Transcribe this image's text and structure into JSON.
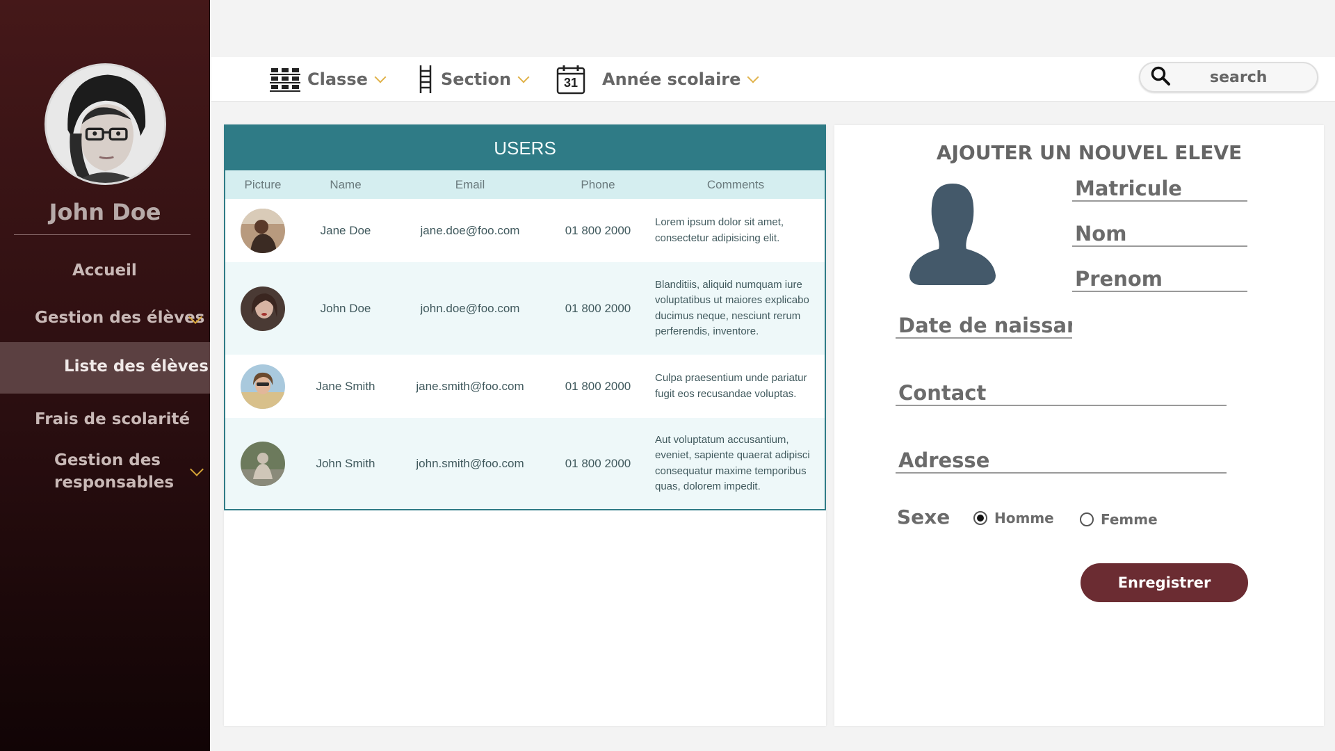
{
  "sidebar": {
    "user_name": "John Doe",
    "items": [
      {
        "label": "Accueil"
      },
      {
        "label": "Gestion des élèves"
      },
      {
        "label": "Liste des élèves"
      },
      {
        "label": "Frais de scolarité"
      },
      {
        "label": "Gestion des\nresponsables"
      }
    ]
  },
  "topbar": {
    "filters": [
      {
        "label": "Classe",
        "icon": "seats-grid-icon"
      },
      {
        "label": "Section",
        "icon": "ladder-icon"
      },
      {
        "label": "Année scolaire",
        "icon": "calendar-icon",
        "icon_text": "31"
      }
    ],
    "search_placeholder": "search"
  },
  "users_table": {
    "title": "USERS",
    "headers": [
      "Picture",
      "Name",
      "Email",
      "Phone",
      "Comments"
    ],
    "rows": [
      {
        "name": "Jane Doe",
        "email": "jane.doe@foo.com",
        "phone": "01 800 2000",
        "comment": "Lorem ipsum dolor sit amet, consectetur adipisicing elit."
      },
      {
        "name": "John Doe",
        "email": "john.doe@foo.com",
        "phone": "01 800 2000",
        "comment": "Blanditiis, aliquid numquam iure voluptatibus ut maiores explicabo ducimus neque, nesciunt rerum perferendis, inventore."
      },
      {
        "name": "Jane Smith",
        "email": "jane.smith@foo.com",
        "phone": "01 800 2000",
        "comment": "Culpa praesentium unde pariatur fugit eos recusandae voluptas."
      },
      {
        "name": "John Smith",
        "email": "john.smith@foo.com",
        "phone": "01 800 2000",
        "comment": "Aut voluptatum accusantium, eveniet, sapiente quaerat adipisci consequatur maxime temporibus quas, dolorem impedit."
      }
    ]
  },
  "form": {
    "title": "AJOUTER UN NOUVEL ELEVE",
    "fields": {
      "matricule": "Matricule",
      "nom": "Nom",
      "prenom": "Prenom",
      "date_naissance": "Date de naissance",
      "contact": "Contact",
      "adresse": "Adresse"
    },
    "sexe_label": "Sexe",
    "sexe_options": [
      "Homme",
      "Femme"
    ],
    "sexe_selected": "Homme",
    "submit_label": "Enregistrer"
  },
  "colors": {
    "sidebar_top": "#451819",
    "table_header": "#2f7b86",
    "button": "#6b2c32",
    "accent_chevron": "#d7a537"
  }
}
